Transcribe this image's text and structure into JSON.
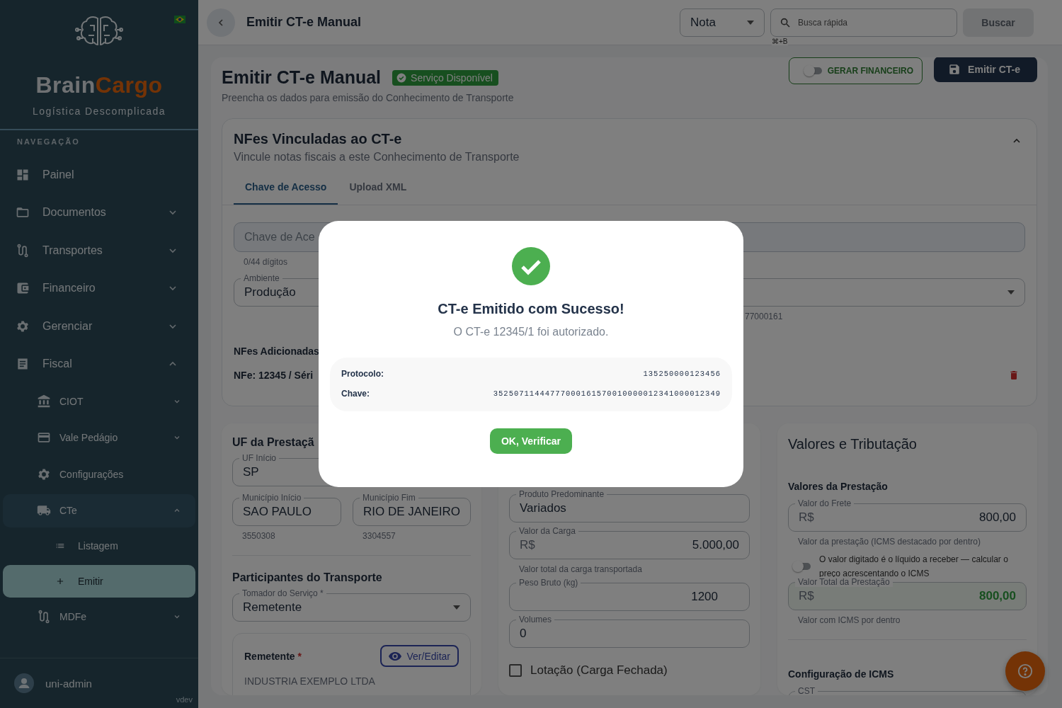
{
  "sidebar": {
    "brand": {
      "first": "Brain",
      "second": "Cargo"
    },
    "tagline": "Logística Descomplicada",
    "section_label": "NAVEGAÇÃO",
    "items": [
      {
        "label": "Painel",
        "kind": "link",
        "selected": false
      },
      {
        "label": "Documentos",
        "kind": "group",
        "expanded": false,
        "selected": false
      },
      {
        "label": "Transportes",
        "kind": "group",
        "expanded": false,
        "selected": false
      },
      {
        "label": "Financeiro",
        "kind": "group",
        "expanded": false,
        "selected": false
      },
      {
        "label": "Gerenciar",
        "kind": "group",
        "expanded": false,
        "selected": false
      },
      {
        "label": "Fiscal",
        "kind": "group",
        "expanded": true,
        "selected": false,
        "children": [
          {
            "label": "CIOT",
            "kind": "group",
            "expanded": false,
            "selected": false
          },
          {
            "label": "Vale Pedágio",
            "kind": "group",
            "expanded": false,
            "selected": false
          },
          {
            "label": "Configurações",
            "kind": "link",
            "selected": false
          },
          {
            "label": "CTe",
            "kind": "group",
            "expanded": true,
            "selected": false,
            "children": [
              {
                "label": "Listagem",
                "selected": false
              },
              {
                "label": "Emitir",
                "selected": true
              }
            ]
          },
          {
            "label": "MDFe",
            "kind": "group",
            "expanded": false,
            "selected": false
          }
        ]
      }
    ],
    "user": "uni-admin",
    "version": "vdev"
  },
  "topbar": {
    "title": "Emitir CT-e Manual",
    "doc_type": "Nota",
    "search": {
      "placeholder": "Busca rápida"
    },
    "shortcut": "⌘+B",
    "search_button": "Buscar"
  },
  "header": {
    "title": "Emitir CT-e Manual",
    "status": "Serviço Disponível",
    "subtitle": "Preencha os dados para emissão do Conhecimento de Transporte",
    "finance_toggle": {
      "label": "GERAR FINANCEIRO",
      "on": false
    },
    "emit_button": "Emitir CT-e"
  },
  "nfes": {
    "title": "NFes Vinculadas ao CT-e",
    "subtitle": "Vincule notas fiscais a este Conhecimento de Transporte",
    "expanded": true,
    "tabs": [
      {
        "label": "Chave de Acesso",
        "selected": true
      },
      {
        "label": "Upload XML",
        "selected": false
      }
    ],
    "key_field": {
      "placeholder": "Chave de Ace"
    },
    "digit_count": "0/44 dígitos",
    "environment": {
      "label": "Ambiente",
      "value": "Produção"
    },
    "right_hint": "77000161",
    "added_title": "NFes Adicionadas",
    "added": [
      {
        "text": "NFe: 12345 / Séri"
      }
    ]
  },
  "uf": {
    "title": "UF da Prestaçã",
    "uf_start": {
      "label": "UF Início",
      "value": "SP"
    },
    "city_start": {
      "label": "Município Início",
      "value": "SAO PAULO",
      "code": "3550308"
    },
    "city_end": {
      "label": "Município Fim",
      "value": "RIO DE JANEIRO",
      "code": "3304557"
    }
  },
  "participants": {
    "title": "Participantes do Transporte",
    "payer": {
      "label": "Tomador do Serviço *",
      "value": "Remetente"
    },
    "sender": {
      "title": "Remetente",
      "required_mark": "*",
      "edit_button": "Ver/Editar",
      "name": "INDUSTRIA EXEMPLO LTDA"
    }
  },
  "cargo": {
    "product": {
      "label": "Produto Predominante",
      "value": "Variados"
    },
    "value": {
      "label": "Valor da Carga",
      "prefix": "R$",
      "value": "5.000,00",
      "hint": "Valor total da carga transportada"
    },
    "weight": {
      "label": "Peso Bruto (kg)",
      "value": "1200"
    },
    "volumes": {
      "label": "Volumes",
      "value": "0"
    },
    "full_load": {
      "label": "Lotação (Carga Fechada)",
      "checked": false
    }
  },
  "values": {
    "title": "Valores e Tributação",
    "section": "Valores da Prestação",
    "freight": {
      "label": "Valor do Frete",
      "prefix": "R$",
      "value": "800,00",
      "hint": "Valor da prestação (ICMS destacado por dentro)"
    },
    "net_toggle": {
      "label": "O valor digitado é o líquido a receber — calcular o preço acrescentando o ICMS",
      "on": false
    },
    "total": {
      "label": "Valor Total da Prestação",
      "prefix": "R$",
      "value": "800,00",
      "hint": "Valor com ICMS por dentro"
    },
    "icms_title": "Configuração de ICMS",
    "cst_label": "CST"
  },
  "dialog": {
    "title": "CT-e Emitido com Sucesso!",
    "message": "O CT-e 12345/1 foi autorizado.",
    "details": [
      {
        "label": "Protocolo:",
        "value": "135250000123456"
      },
      {
        "label": "Chave:",
        "value": "35250711444777000161570010000012341000012349"
      }
    ],
    "button": "OK, Verificar"
  }
}
